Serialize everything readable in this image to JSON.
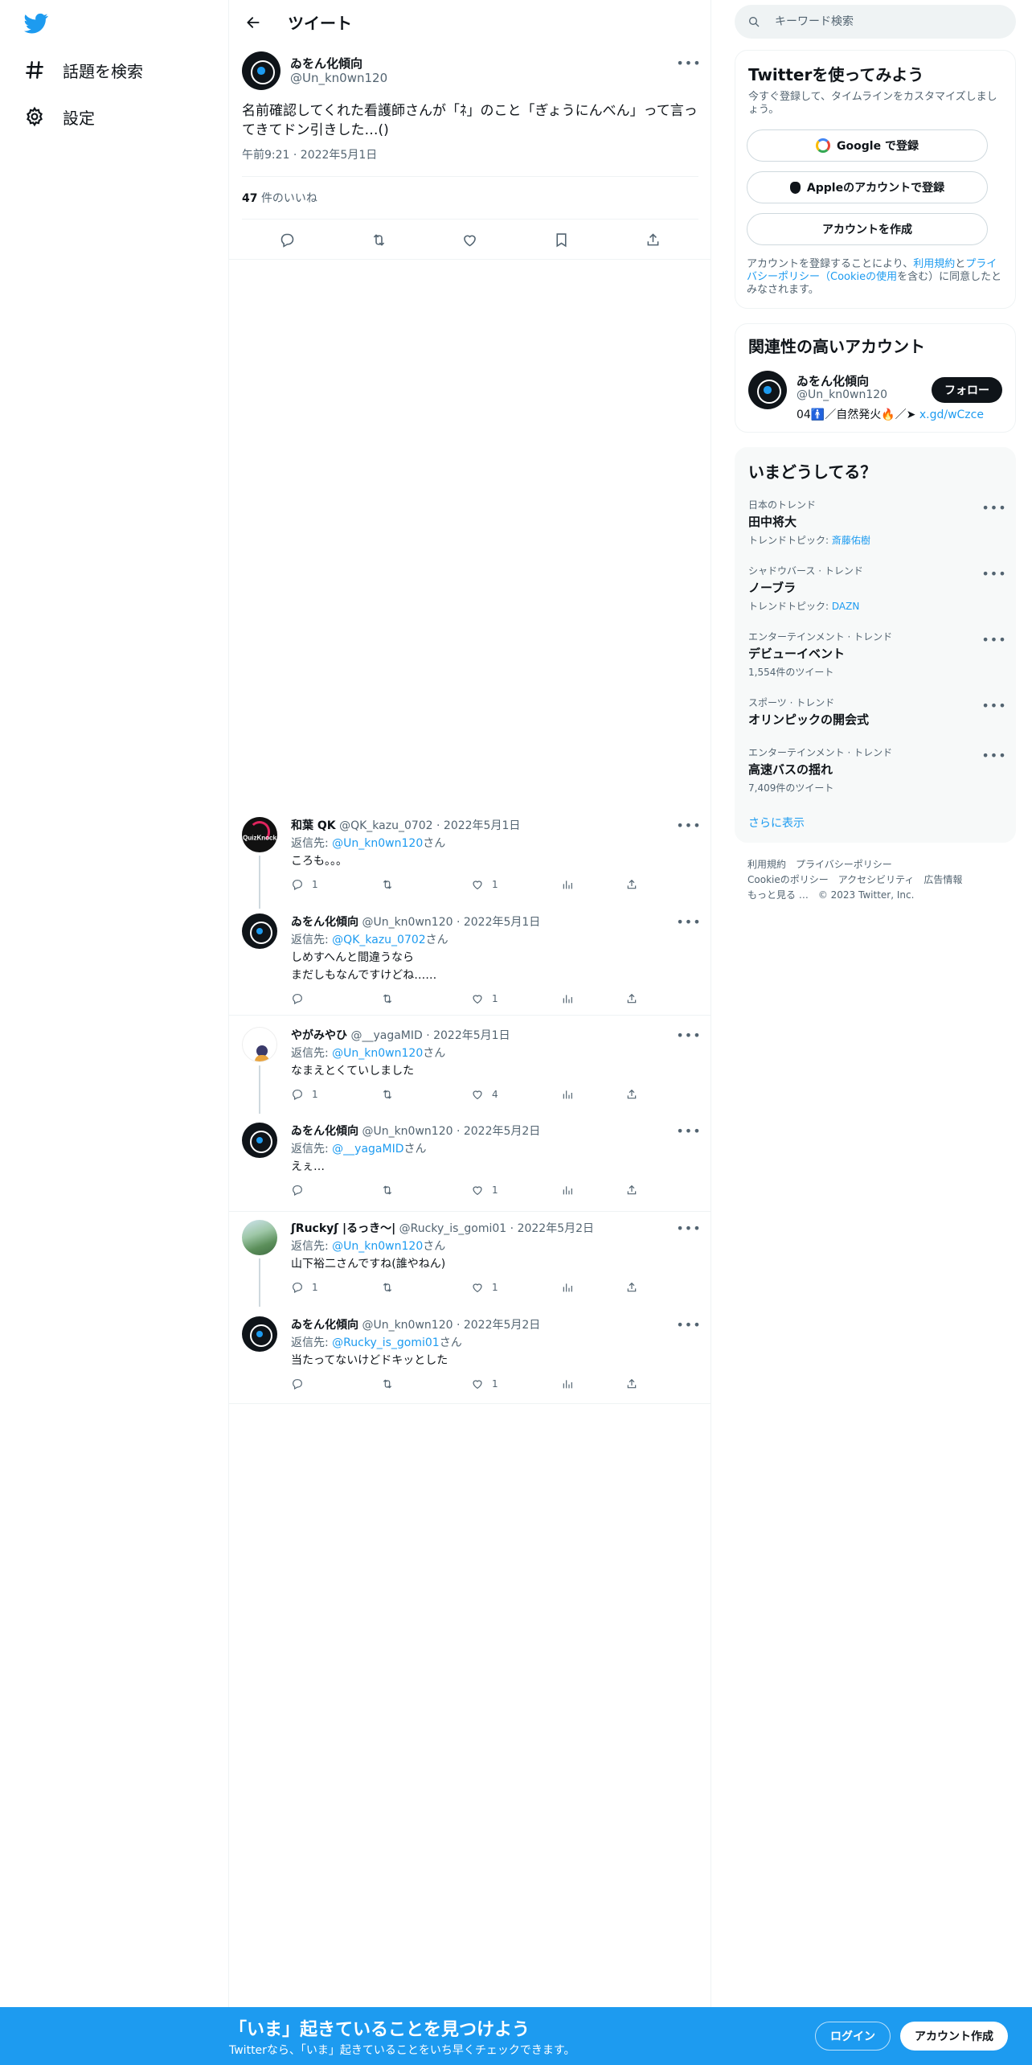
{
  "nav": {
    "explore_label": "話題を検索",
    "settings_label": "設定"
  },
  "header": {
    "title": "ツイート"
  },
  "main_tweet": {
    "author_name": "ゐをん化傾向",
    "author_handle": "@Un_kn0wn120",
    "text": "名前確認してくれた看護師さんが「ﾈ」のこと「ぎょうにんべん」って言ってきてドン引きした…()",
    "timestamp": "午前9:21 · 2022年5月1日",
    "likes_count": "47",
    "likes_label": "件のいいね"
  },
  "replies": [
    {
      "name": "和葉 QK",
      "meta": "@QK_kazu_0702 · 2022年5月1日",
      "reply_to_prefix": "返信先: ",
      "reply_to": "@Un_kn0wn120",
      "reply_to_suffix": "さん",
      "text": "ころも。。。",
      "reply_count": "1",
      "retweet_count": "",
      "like_count": "1"
    },
    {
      "name": "ゐをん化傾向",
      "meta": "@Un_kn0wn120 · 2022年5月1日",
      "reply_to_prefix": "返信先: ",
      "reply_to": "@QK_kazu_0702",
      "reply_to_suffix": "さん",
      "text": "しめすへんと間違うなら\nまだしもなんですけどね……",
      "reply_count": "",
      "retweet_count": "",
      "like_count": "1"
    },
    {
      "name": "やがみやひ",
      "meta": "@__yagaMID · 2022年5月1日",
      "reply_to_prefix": "返信先: ",
      "reply_to": "@Un_kn0wn120",
      "reply_to_suffix": "さん",
      "text": "なまえとくていしました",
      "reply_count": "1",
      "retweet_count": "",
      "like_count": "4"
    },
    {
      "name": "ゐをん化傾向",
      "meta": "@Un_kn0wn120 · 2022年5月2日",
      "reply_to_prefix": "返信先: ",
      "reply_to": "@__yagaMID",
      "reply_to_suffix": "さん",
      "text": "えぇ…",
      "reply_count": "",
      "retweet_count": "",
      "like_count": "1"
    },
    {
      "name": "ʃRuckyʃ |るっき〜|",
      "meta": "@Rucky_is_gomi01 · 2022年5月2日",
      "reply_to_prefix": "返信先: ",
      "reply_to": "@Un_kn0wn120",
      "reply_to_suffix": "さん",
      "text": "山下裕二さんですね(誰やねん)",
      "reply_count": "1",
      "retweet_count": "",
      "like_count": "1"
    },
    {
      "name": "ゐをん化傾向",
      "meta": "@Un_kn0wn120 · 2022年5月2日",
      "reply_to_prefix": "返信先: ",
      "reply_to": "@Rucky_is_gomi01",
      "reply_to_suffix": "さん",
      "text": "当たってないけどドキッとした",
      "reply_count": "",
      "retweet_count": "",
      "like_count": "1"
    }
  ],
  "search": {
    "placeholder": "キーワード検索"
  },
  "signup_card": {
    "title": "Twitterを使ってみよう",
    "subtitle": "今すぐ登録して、タイムラインをカスタマイズしましょう。",
    "google_label": "Google で登録",
    "apple_label": "Appleのアカウントで登録",
    "create_label": "アカウントを作成",
    "legal_prefix": "アカウントを登録することにより、",
    "legal_terms": "利用規約",
    "legal_and": "と",
    "legal_privacy": "プライバシーポリシー",
    "legal_cookie": "（Cookieの使用",
    "legal_suffix": "を含む）に同意したとみなされます。"
  },
  "related_card": {
    "title": "関連性の高いアカウント",
    "name": "ゐをん化傾向",
    "handle": "@Un_kn0wn120",
    "bio": "04🚹／自然発火🔥／➤ ",
    "bio_link": "x.gd/wCzce",
    "follow_label": "フォロー"
  },
  "trends_card": {
    "title": "いまどうしてる？",
    "items": [
      {
        "context": "日本のトレンド",
        "title": "田中将大",
        "sub_prefix": "トレンドトピック: ",
        "sub_link": "斎藤佑樹",
        "sub": ""
      },
      {
        "context": "シャドウバース · トレンド",
        "title": "ノーブラ",
        "sub_prefix": "トレンドトピック: ",
        "sub_link": "DAZN",
        "sub": ""
      },
      {
        "context": "エンターテインメント · トレンド",
        "title": "デビューイベント",
        "sub_prefix": "",
        "sub_link": "",
        "sub": "1,554件のツイート"
      },
      {
        "context": "スポーツ · トレンド",
        "title": "オリンピックの開会式",
        "sub_prefix": "",
        "sub_link": "",
        "sub": ""
      },
      {
        "context": "エンターテインメント · トレンド",
        "title": "高速バスの揺れ",
        "sub_prefix": "",
        "sub_link": "",
        "sub": "7,409件のツイート"
      }
    ],
    "show_more_label": "さらに表示"
  },
  "footer": {
    "terms": "利用規約",
    "privacy": "プライバシーポリシー",
    "cookie": "Cookieのポリシー",
    "accessibility": "アクセシビリティ",
    "ads": "広告情報",
    "more": "もっと見る …",
    "copyright": "© 2023 Twitter, Inc."
  },
  "bottom_bar": {
    "title": "「いま」起きていることを見つけよう",
    "subtitle": "Twitterなら、「いま」起きていることをいち早くチェックできます。",
    "login_label": "ログイン",
    "signup_label": "アカウント作成"
  },
  "colors": {
    "accent": "#1d9bf0",
    "text_primary": "#0f1419",
    "text_secondary": "#536471",
    "border": "#eff3f4"
  },
  "icons": {
    "logo": "twitter-bird-icon",
    "explore": "hashtag-icon",
    "settings": "gear-icon",
    "back": "back-arrow-icon",
    "more": "more-dots-icon",
    "reply": "reply-icon",
    "retweet": "retweet-icon",
    "like": "heart-icon",
    "bookmark": "bookmark-icon",
    "share": "share-icon",
    "views": "analytics-icon",
    "search": "search-icon"
  }
}
